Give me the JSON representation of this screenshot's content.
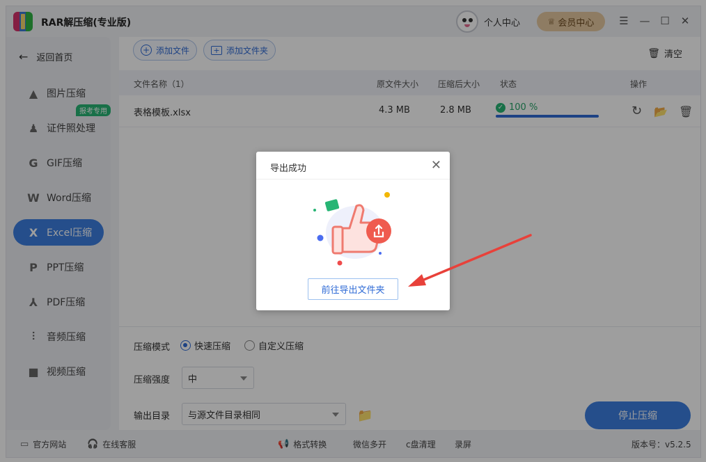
{
  "app": {
    "title": "RAR解压缩(专业版)"
  },
  "header": {
    "personal_center": "个人中心",
    "vip_center": "会员中心"
  },
  "window_controls": {
    "menu": "☰",
    "minimize": "—",
    "maximize": "☐",
    "close": "✕"
  },
  "sidebar": {
    "back_label": "返回首页",
    "items": [
      {
        "label": "图片压缩",
        "icon": "image-icon",
        "glyph": "▲"
      },
      {
        "label": "证件照处理",
        "icon": "id-photo-icon",
        "glyph": "♟"
      },
      {
        "label": "GIF压缩",
        "icon": "gif-icon",
        "glyph": "G"
      },
      {
        "label": "Word压缩",
        "icon": "word-icon",
        "glyph": "W"
      },
      {
        "label": "Excel压缩",
        "icon": "excel-icon",
        "glyph": "X"
      },
      {
        "label": "PPT压缩",
        "icon": "ppt-icon",
        "glyph": "P"
      },
      {
        "label": "PDF压缩",
        "icon": "pdf-icon",
        "glyph": "⅄"
      },
      {
        "label": "音频压缩",
        "icon": "audio-icon",
        "glyph": "⫶"
      },
      {
        "label": "视频压缩",
        "icon": "video-icon",
        "glyph": "■"
      }
    ],
    "active_index": 4,
    "tag_label": "报考专用"
  },
  "toolbar": {
    "add_file": "添加文件",
    "add_folder": "添加文件夹",
    "clear": "清空"
  },
  "table": {
    "headers": {
      "name": "文件名称（1）",
      "orig_size": "原文件大小",
      "comp_size": "压缩后大小",
      "status": "状态",
      "ops": "操作"
    },
    "rows": [
      {
        "name": "表格模板.xlsx",
        "orig_size": "4.3 MB",
        "comp_size": "2.8 MB",
        "status": "100 %",
        "progress": 1.0
      }
    ]
  },
  "settings": {
    "mode_label": "压缩模式",
    "mode_fast": "快速压缩",
    "mode_custom": "自定义压缩",
    "strength_label": "压缩强度",
    "strength_value": "中",
    "output_label": "输出目录",
    "output_value": "与源文件目录相同",
    "stop_button": "停止压缩"
  },
  "footer": {
    "website": "官方网站",
    "support": "在线客服",
    "format": "格式转换",
    "wechat": "微信多开",
    "cclean": "c盘清理",
    "record": "录屏",
    "version": "版本号：v5.2.5"
  },
  "dialog": {
    "title": "导出成功",
    "button": "前往导出文件夹"
  },
  "colors": {
    "accent": "#3d7fe0",
    "success": "#27b574",
    "overlay": "rgba(0,0,0,0.38)",
    "annotation_arrow": "#e8413a"
  }
}
